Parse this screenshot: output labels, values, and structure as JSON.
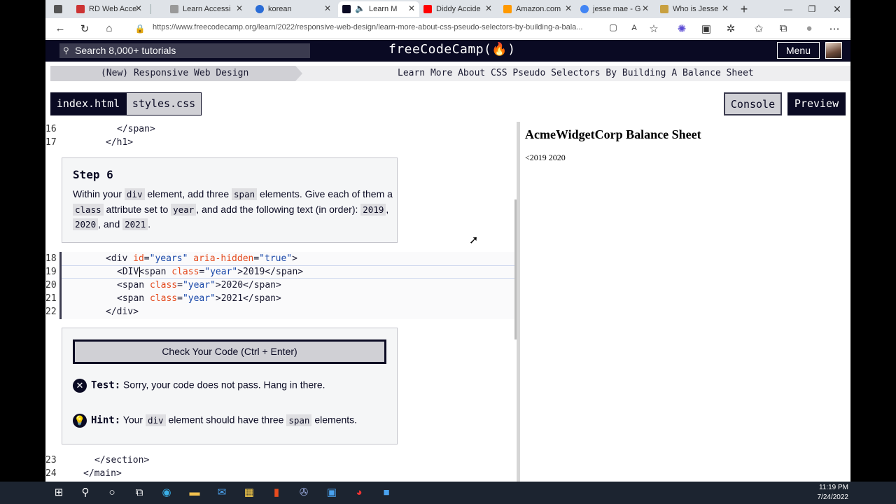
{
  "browser": {
    "tabs": [
      {
        "label": "",
        "color": "#555"
      },
      {
        "label": "RD Web Acce",
        "color": "#c33"
      },
      {
        "label": "Learn Accessi",
        "color": "#999"
      },
      {
        "label": "korean",
        "color": "#2a6cd6"
      },
      {
        "label": "Learn M",
        "color": "#0a0a23"
      },
      {
        "label": "Diddy Accide",
        "color": "#f00"
      },
      {
        "label": "Amazon.com",
        "color": "#f90"
      },
      {
        "label": "jesse mae - G",
        "color": "#4285f4"
      },
      {
        "label": "Who is Jesse",
        "color": "#c8a040"
      }
    ],
    "url": "https://www.freecodecamp.org/learn/2022/responsive-web-design/learn-more-about-css-pseudo-selectors-by-building-a-bala..."
  },
  "fcc": {
    "search_placeholder": "Search 8,000+ tutorials",
    "logo": "freeCodeCamp(🔥)",
    "menu": "Menu"
  },
  "breadcrumb": {
    "left": "(New) Responsive Web Design",
    "right": "Learn More About CSS Pseudo Selectors By Building A Balance Sheet"
  },
  "editor_tabs": {
    "index": "index.html",
    "styles": "styles.css",
    "console": "Console",
    "preview": "Preview"
  },
  "code": {
    "ln16": "16",
    "ln17": "17",
    "ln18": "18",
    "ln19": "19",
    "ln20": "20",
    "ln21": "21",
    "ln22": "22",
    "ln23": "23",
    "ln24": "24",
    "l16": "</span>",
    "l17": "</h1>",
    "l23": "</section>",
    "l24": "</main>"
  },
  "step": {
    "title": "Step 6",
    "t1": "Within your ",
    "c1": "div",
    "t2": " element, add three ",
    "c2": "span",
    "t3": " elements. Give each of them a ",
    "c3": "class",
    "t4": " attribute set to ",
    "c4": "year",
    "t5": ", and add the following text (in order): ",
    "c5": "2019",
    "t6": ", ",
    "c6": "2020",
    "t7": ", and ",
    "c7": "2021",
    "t8": "."
  },
  "test": {
    "check_button": "Check Your Code (Ctrl + Enter)",
    "test_label": "Test:",
    "test_msg": "Sorry, your code does not pass. Hang in there.",
    "hint_label": "Hint:",
    "hint_t1": "Your ",
    "hint_c1": "div",
    "hint_t2": " element should have three ",
    "hint_c2": "span",
    "hint_t3": " elements."
  },
  "preview": {
    "title": "AcmeWidgetCorp Balance Sheet",
    "years": "<2019 2020"
  },
  "taskbar": {
    "time": "11:19 PM",
    "date": "7/24/2022"
  }
}
